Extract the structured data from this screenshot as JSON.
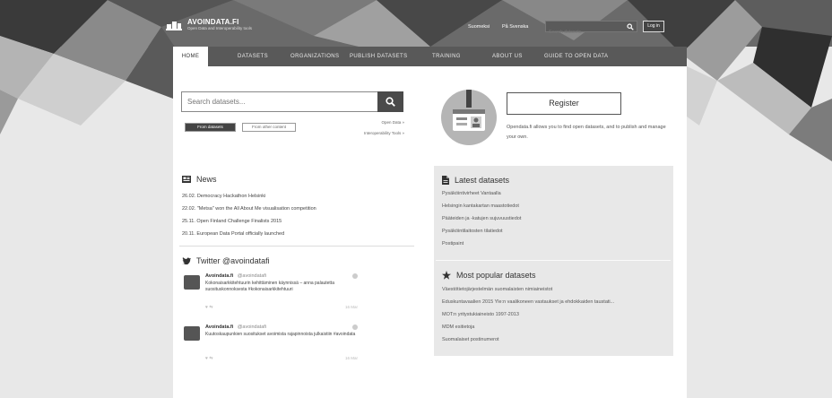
{
  "header": {
    "logo_title": "AVOINDATA.FI",
    "logo_subtitle": "Open Data and Interoperability tools",
    "lang_fi": "Suomeksi",
    "lang_sv": "På Svenska",
    "search_placeholder": "Search datasets...",
    "login_label": "Log in"
  },
  "nav": {
    "items": [
      {
        "label": "HOME",
        "active": true
      },
      {
        "label": "DATASETS"
      },
      {
        "label": "ORGANIZATIONS"
      },
      {
        "label": "PUBLISH DATASETS"
      },
      {
        "label": "TRAINING"
      },
      {
        "label": "ABOUT US"
      },
      {
        "label": "GUIDE TO OPEN DATA"
      }
    ]
  },
  "search": {
    "placeholder": "Search datasets...",
    "tab_datasets": "From datasets",
    "tab_other": "From other content",
    "link_open_data": "Open Data »",
    "link_tools": "Interoperability Tools »"
  },
  "register": {
    "button_label": "Register",
    "description": "Opendata.fi allows you to find open datasets, and to publish and manage your own."
  },
  "news": {
    "title": "News",
    "items": [
      "26.02.  Democracy Hackathon Helsinki",
      "22.02.  \"Metsa\" won the All About Me visualisation competition",
      "25.11.  Open Finland Challenge Finalists 2015",
      "20.11.  European Data Portal officially launched"
    ]
  },
  "twitter": {
    "title": "Twitter @avoindatafi",
    "tweets": [
      {
        "name": "Avoindata.fi",
        "handle": "@avoindatafi",
        "text": "Kokonaisarkkitehtuurin kehittäminen käynnissä – anna palautetta suosituskonnoksesta #kokonaisarkkitehtuuri",
        "actions": "♥  ⇆",
        "date": "16 Mar"
      },
      {
        "name": "Avoindata.fi",
        "handle": "@avoindatafi",
        "text": "Kuutoskaupunkien suositukset avoimista rajapinnoista julkaistiin #avoindata",
        "actions": "♥  ⇆",
        "date": "16 Mar"
      }
    ]
  },
  "latest": {
    "title": "Latest datasets",
    "items": [
      "Pysäköintivirheet Vantaalla",
      "Helsingin kantakartan maastotiedot",
      "Pääteiden ja -katujen sujuvuustiedot",
      "Pysäköintilaitosten tilatiedot",
      "Postipaint"
    ]
  },
  "popular": {
    "title": "Most popular datasets",
    "items": [
      "Väestötietojärjestelmän suomalaisten nimiaineistot",
      "Eduskuntavaalien 2015 Yle:n vaalikoneen vastaukset ja ehdokkaiden taustati...",
      "MOT:n yritystukiaineisto 1997-2013",
      "MDM esitietoja",
      "Suomalaiset postinumerot"
    ]
  },
  "colors": {
    "nav_bg": "#595959",
    "page_bg": "#e6e6e6",
    "panel_bg": "#e8e8e8"
  }
}
